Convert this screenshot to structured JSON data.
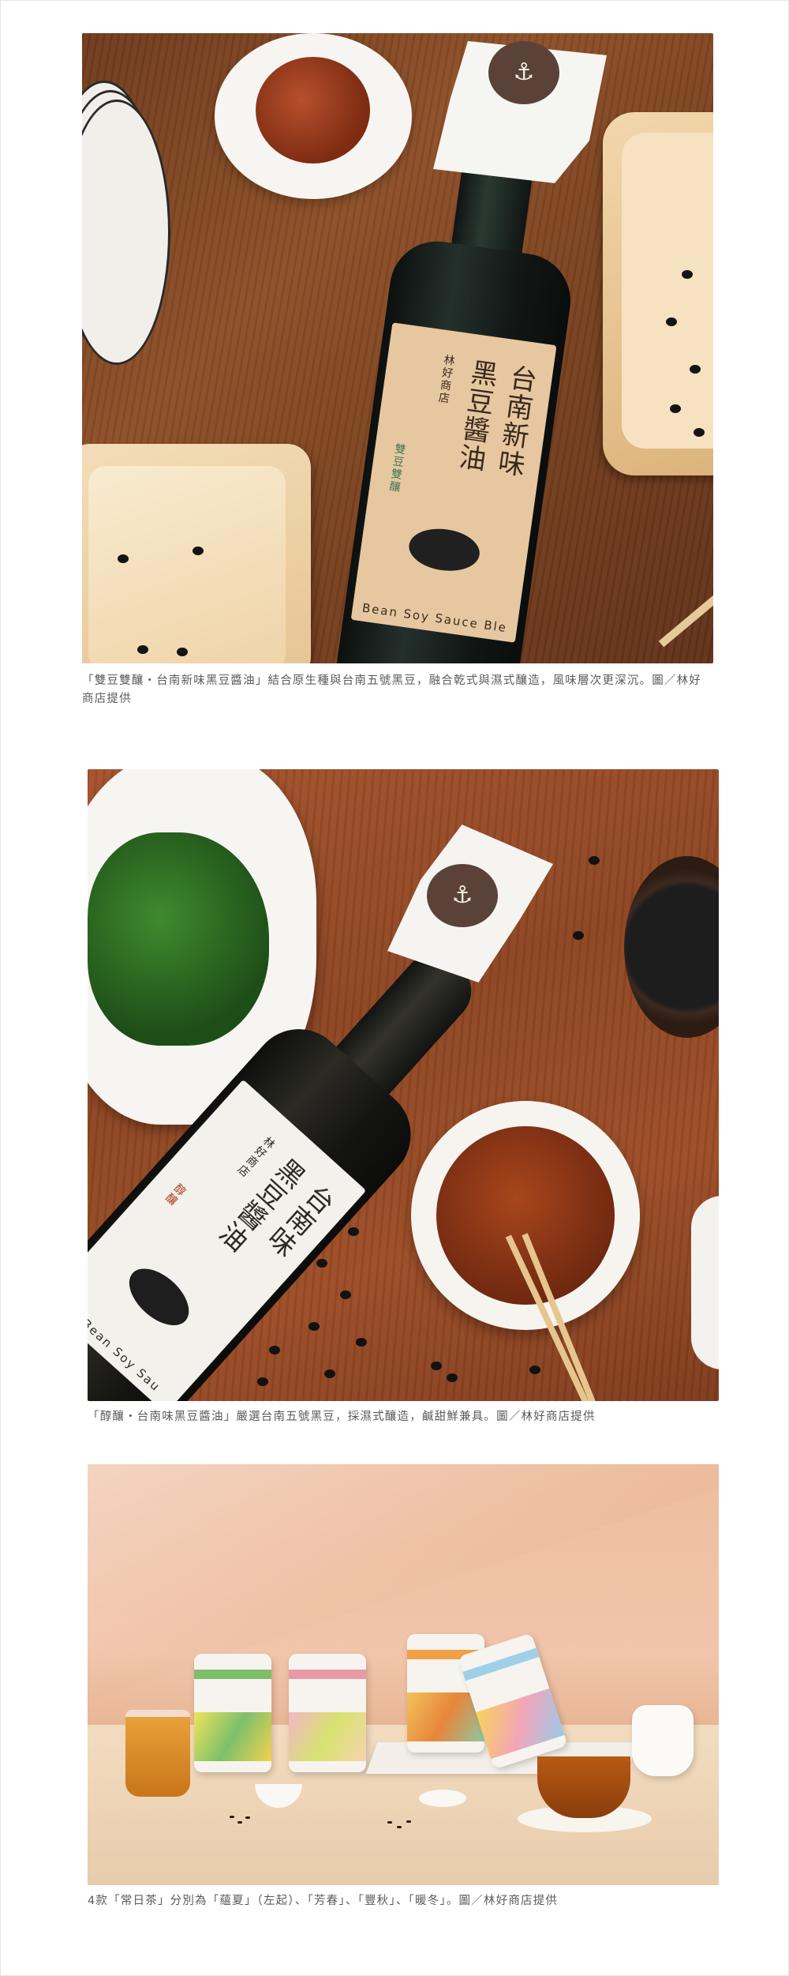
{
  "captions": {
    "photo1": "「雙豆雙釀・台南新味黑豆醬油」結合原生種與台南五號黑豆，融合乾式與濕式釀造，風味層次更深沉。圖／林好商店提供",
    "photo2": "「醇釀・台南味黑豆醬油」嚴選台南五號黑豆，採濕式釀造，鹹甜鮮兼具。圖／林好商店提供",
    "photo3": "4款「常日茶」分別為「蘊夏」（左起）、「芳春」、「豐秋」、「暖冬」。圖／林好商店提供"
  },
  "photo1": {
    "label_col1": "台南新味",
    "label_col2": "黑豆醬油",
    "brand": "林好商店",
    "badge": "雙豆雙釀",
    "english": "Bean Soy Sauce Ble"
  },
  "photo2": {
    "label_col1": "台南味",
    "label_col2": "黑豆醬油",
    "brand": "林好商店",
    "badge": "醇釀",
    "english": "ck Bean Soy Sau"
  },
  "colors": {
    "caption_text": "#5b5b5b",
    "wood_dark": "#7a411f",
    "wall_peach": "#f1c5aa"
  }
}
